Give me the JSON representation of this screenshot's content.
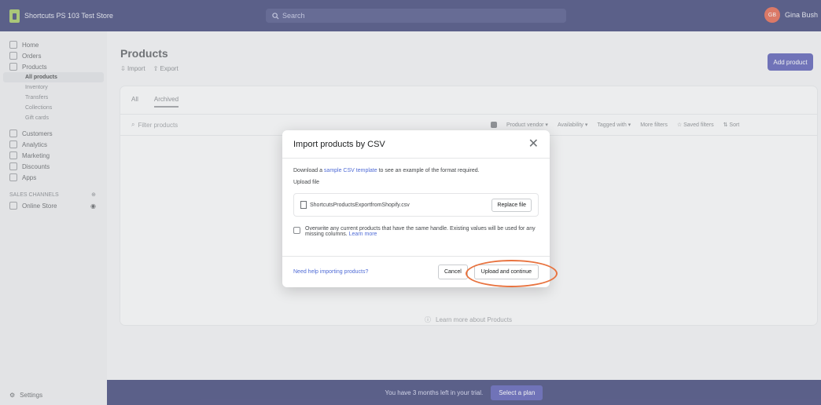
{
  "topbar": {
    "store_name": "Shortcuts PS 103 Test Store",
    "search_placeholder": "Search",
    "user_initials": "GB",
    "user_name": "Gina Bush"
  },
  "sidebar": {
    "items": [
      {
        "label": "Home",
        "icon": "home-icon"
      },
      {
        "label": "Orders",
        "icon": "orders-icon"
      },
      {
        "label": "Products",
        "icon": "tag-icon"
      }
    ],
    "sub_items": [
      "All products",
      "Inventory",
      "Transfers",
      "Collections",
      "Gift cards"
    ],
    "items_after": [
      {
        "label": "Customers",
        "icon": "person-icon"
      },
      {
        "label": "Analytics",
        "icon": "chart-icon"
      },
      {
        "label": "Marketing",
        "icon": "megaphone-icon"
      },
      {
        "label": "Discounts",
        "icon": "discount-icon"
      },
      {
        "label": "Apps",
        "icon": "apps-icon"
      }
    ],
    "section_label": "SALES CHANNELS",
    "channel": "Online Store",
    "settings": "Settings"
  },
  "page": {
    "title": "Products",
    "import": "Import",
    "export": "Export",
    "add_product": "Add product",
    "tabs": [
      "All",
      "Archived"
    ],
    "filter_placeholder": "Filter products",
    "filters": [
      "Product vendor",
      "Availability",
      "Tagged with",
      "More filters",
      "Saved filters",
      "Sort"
    ],
    "empty_text": "Learn more about Products"
  },
  "modal": {
    "title": "Import products by CSV",
    "intro_prefix": "Download a",
    "intro_link": "sample CSV template",
    "intro_suffix": "to see an example of the format required.",
    "upload_label": "Upload file",
    "file_name": "ShortcutsProductsExportfromShopify.csv",
    "replace_file": "Replace file",
    "overwrite_text": "Overwrite any current products that have the same handle. Existing values will be used for any missing columns.",
    "learn_more": "Learn more",
    "help_link": "Need help importing products?",
    "cancel": "Cancel",
    "upload_continue": "Upload and continue"
  },
  "banner": {
    "text": "You have 3 months left in your trial.",
    "button": "Select a plan"
  },
  "colors": {
    "topbar": "#1c2260",
    "accent": "#3c40a8",
    "highlight": "#e8733f",
    "logo": "#95bf47"
  }
}
